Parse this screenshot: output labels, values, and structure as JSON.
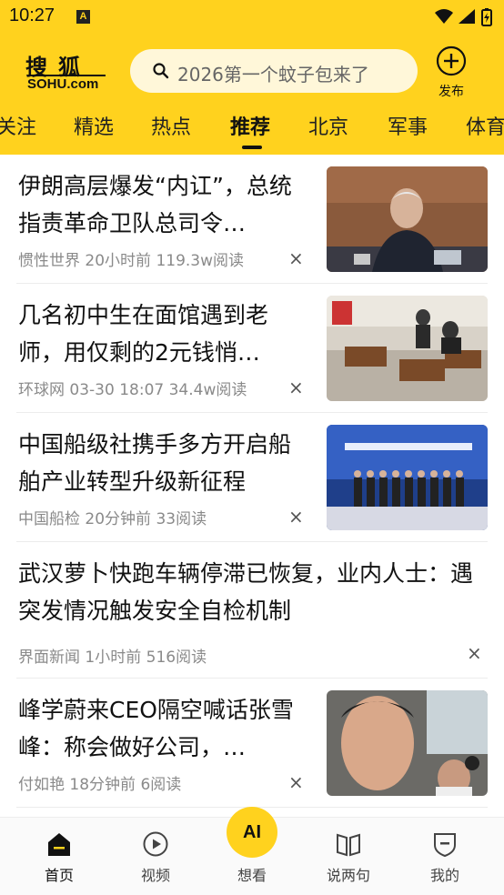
{
  "status": {
    "time": "10:27",
    "notif_badge": "A"
  },
  "header": {
    "logo_top": "搜狐",
    "logo_bottom": "SOHU.com",
    "search_placeholder": "2026第一个蚊子包来了",
    "publish_label": "发布",
    "accent_color": "#FFD21E"
  },
  "tabs": [
    {
      "label": "关注"
    },
    {
      "label": "精选"
    },
    {
      "label": "热点"
    },
    {
      "label": "推荐",
      "active": true
    },
    {
      "label": "北京"
    },
    {
      "label": "军事"
    },
    {
      "label": "体育"
    }
  ],
  "feed": [
    {
      "title": "伊朗高层爆发“内讧”，总统指责革命卫队总司令…",
      "meta": "惯性世界 20小时前 119.3w阅读",
      "has_image": true
    },
    {
      "title": "几名初中生在面馆遇到老师，用仅剩的2元钱悄…",
      "meta": "环球网 03-30 18:07 34.4w阅读",
      "has_image": true
    },
    {
      "title": "中国船级社携手多方开启船舶产业转型升级新征程",
      "meta": "中国船检 20分钟前 33阅读",
      "has_image": true
    },
    {
      "title": "武汉萝卜快跑车辆停滞已恢复，业内人士：遇突发情况触发安全自检机制",
      "meta": "界面新闻 1小时前 516阅读",
      "has_image": false
    },
    {
      "title": "峰学蔚来CEO隔空喊话张雪峰：称会做好公司，…",
      "meta": "付如艳 18分钟前 6阅读",
      "has_image": true
    }
  ],
  "dismiss_icon": "×",
  "bottom_nav": [
    {
      "label": "首页",
      "icon": "home-icon",
      "active": true
    },
    {
      "label": "视频",
      "icon": "play-circle-icon"
    },
    {
      "label": "想看",
      "icon": "ai-icon",
      "badge": "AI"
    },
    {
      "label": "说两句",
      "icon": "book-icon"
    },
    {
      "label": "我的",
      "icon": "shield-icon"
    }
  ]
}
